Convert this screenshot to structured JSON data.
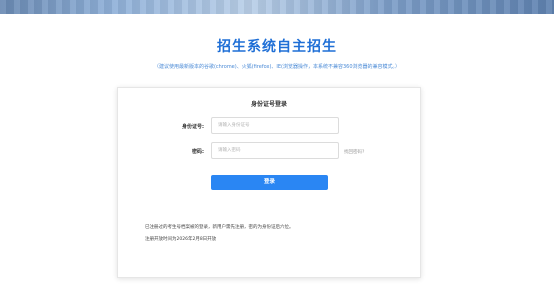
{
  "header": {
    "title": "招生系统自主招生",
    "notice": "（建议使用最新版本的谷歌(chrome)、火狐(firefox)、IE(浏览器操作，本系统不兼容360浏览器的兼容模式。）"
  },
  "login": {
    "card_title": "身份证号登录",
    "id_label": "身份证号:",
    "id_placeholder": "请输入身份证号",
    "password_label": "密码:",
    "password_placeholder": "请输入密码",
    "forgot_label": "找回密码?",
    "submit_label": "登录"
  },
  "info": {
    "line1": "已注册过的考生号档案被的登录，新用户需先注册，密的为身份证后六位。",
    "line2": "注册开放时间为2026年2月8日开放"
  }
}
